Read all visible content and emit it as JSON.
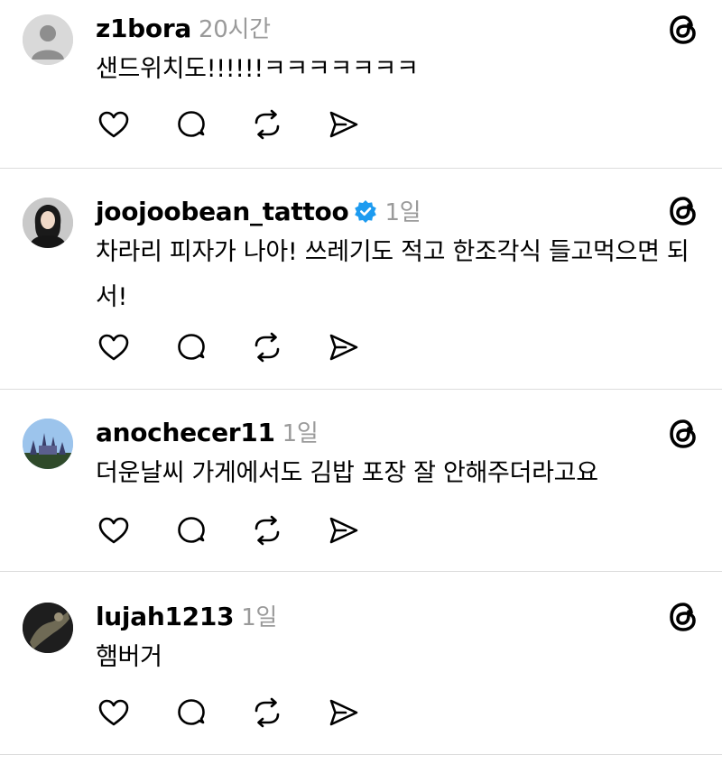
{
  "posts": [
    {
      "username": "z1bora",
      "time": "20시간",
      "verified": false,
      "text": "샌드위치도!!!!!!ㅋㅋㅋㅋㅋㅋㅋ",
      "avatar": "default-avatar-icon"
    },
    {
      "username": "joojoobean_tattoo",
      "time": "1일",
      "verified": true,
      "text": "차라리 피자가 나아! 쓰레기도 적고 한조각식 들고먹으면 되서!",
      "avatar": "profile-photo"
    },
    {
      "username": "anochecer11",
      "time": "1일",
      "verified": false,
      "text": "더운날씨 가게에서도 김밥 포장 잘 안해주더라고요",
      "avatar": "profile-photo"
    },
    {
      "username": "lujah1213",
      "time": "1일",
      "verified": false,
      "text": "햄버거",
      "avatar": "profile-photo"
    }
  ],
  "icons": {
    "like": "heart-icon",
    "comment": "comment-icon",
    "repost": "repost-icon",
    "share": "share-icon",
    "app": "threads-logo-icon",
    "verified": "verified-badge-icon"
  },
  "colors": {
    "verified": "#1d9bf0",
    "meta_text": "#9a9a9a",
    "divider": "#dcdcdc"
  }
}
